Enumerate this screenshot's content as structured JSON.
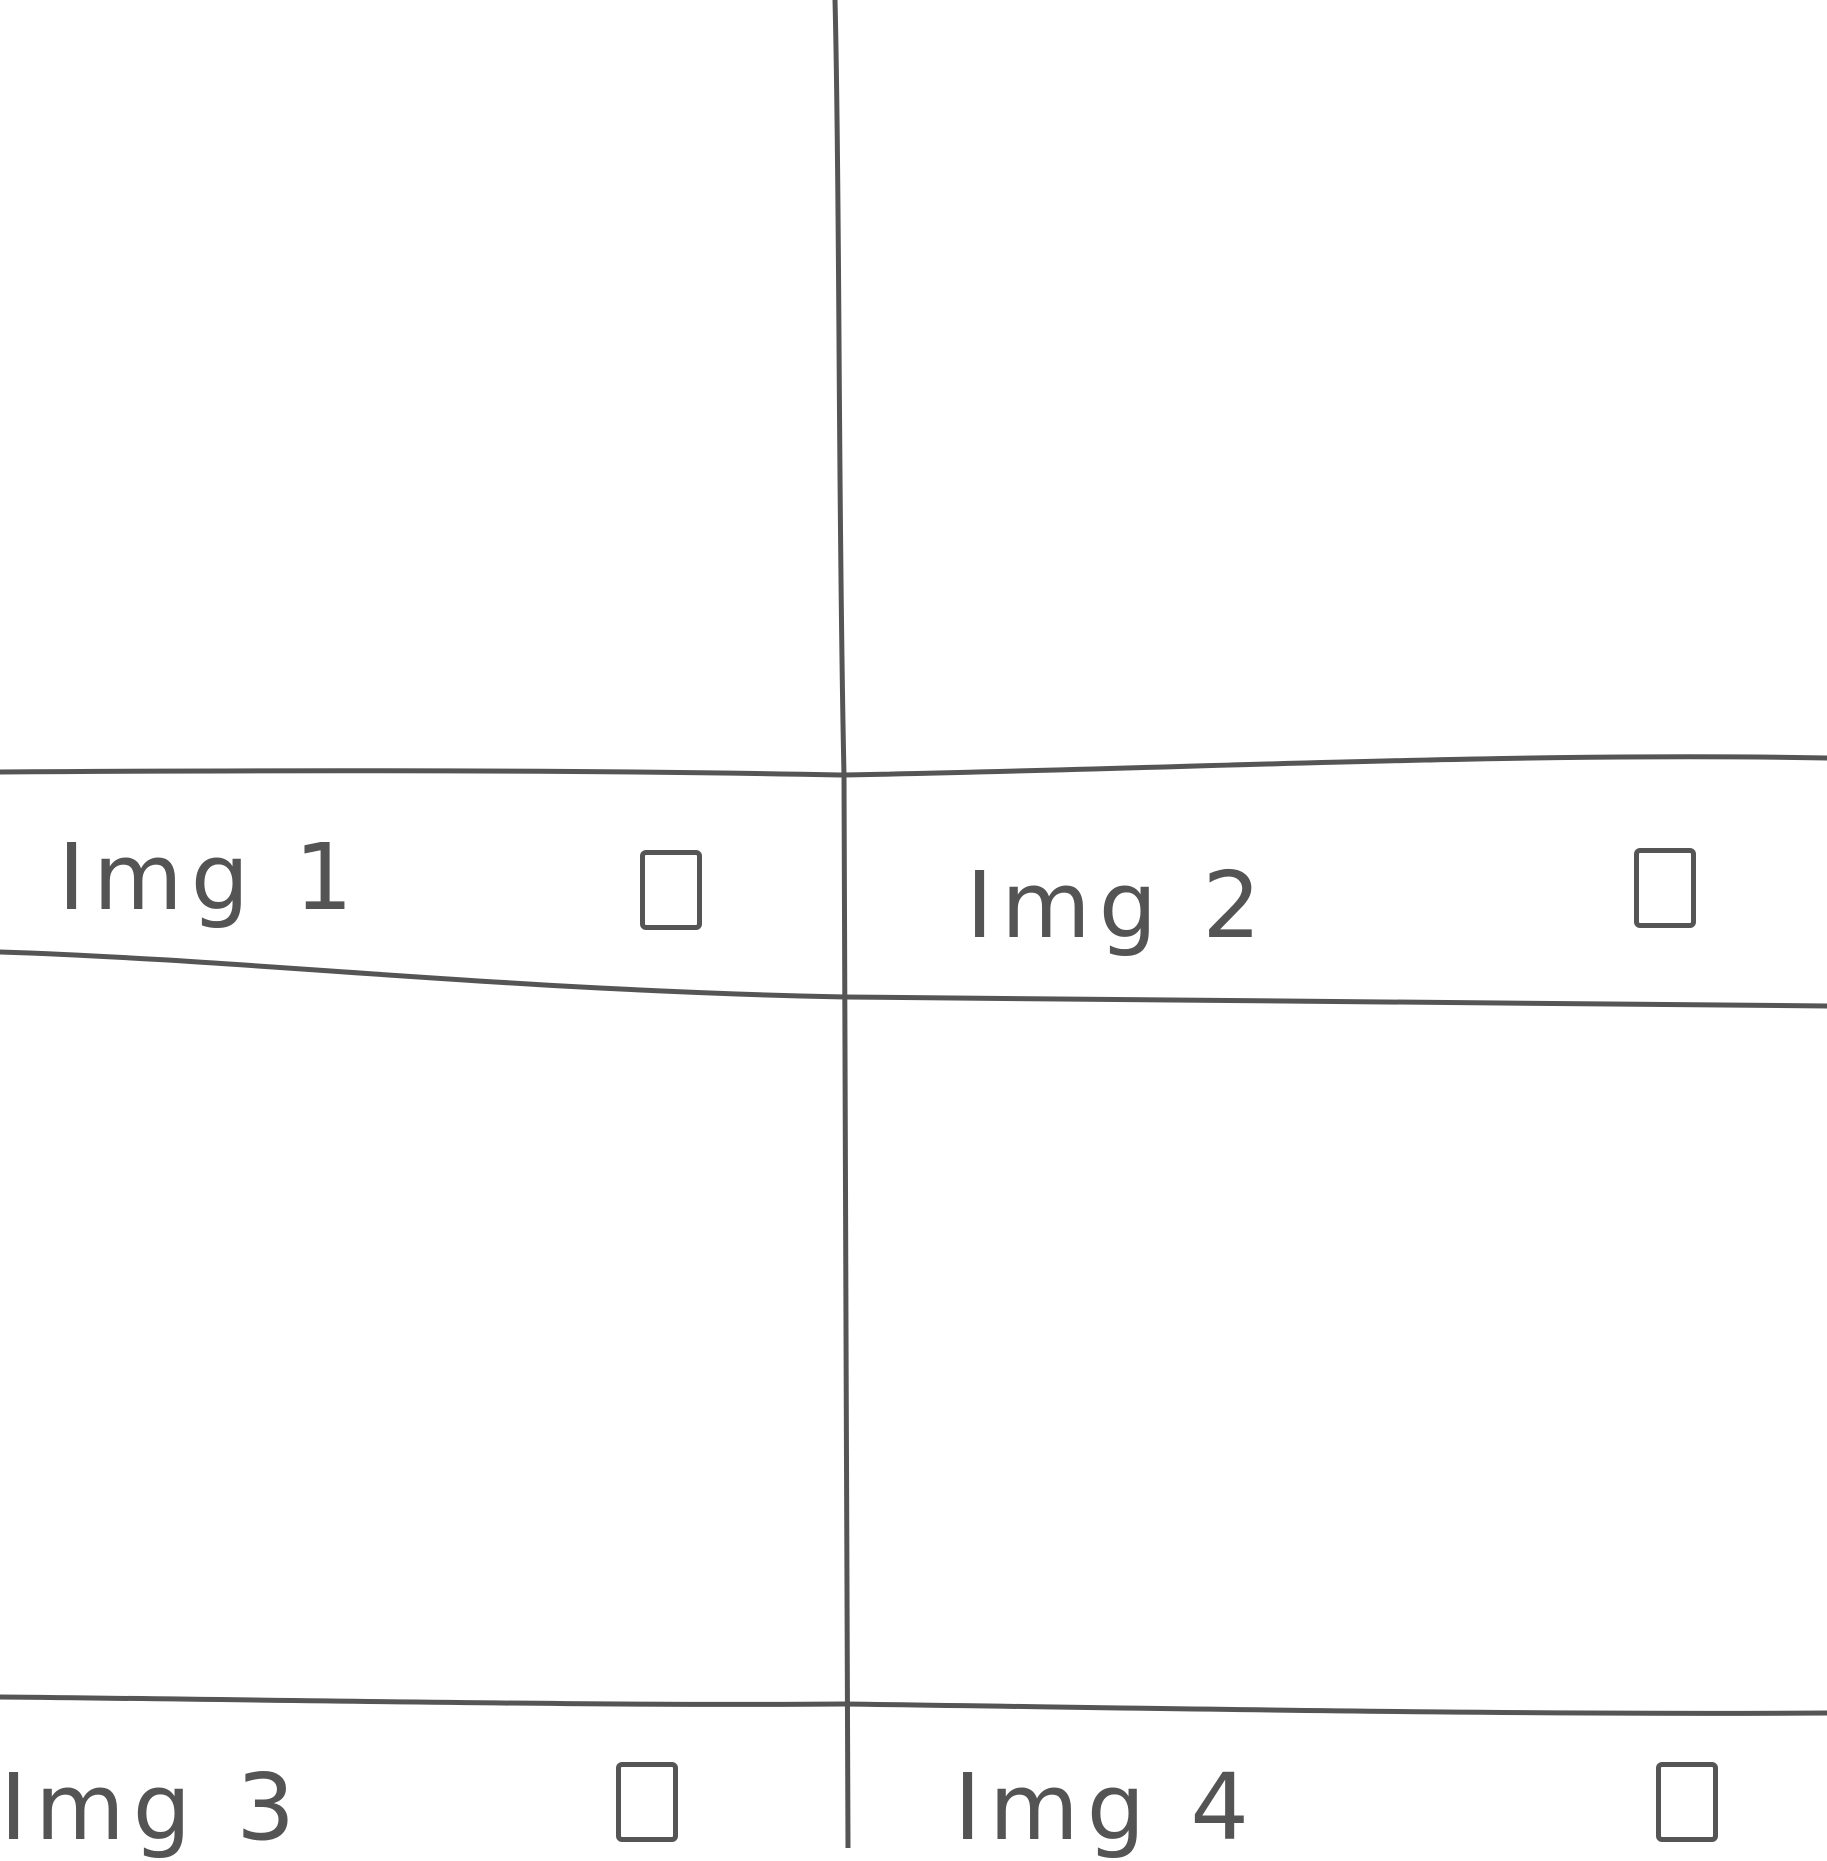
{
  "gallery": {
    "items": [
      {
        "label": "Img 1",
        "checked": false
      },
      {
        "label": "Img 2",
        "checked": false
      },
      {
        "label": "Img 3",
        "checked": false
      },
      {
        "label": "Img 4",
        "checked": false
      }
    ]
  },
  "colors": {
    "ink": "#555555",
    "paper": "#ffffff"
  }
}
